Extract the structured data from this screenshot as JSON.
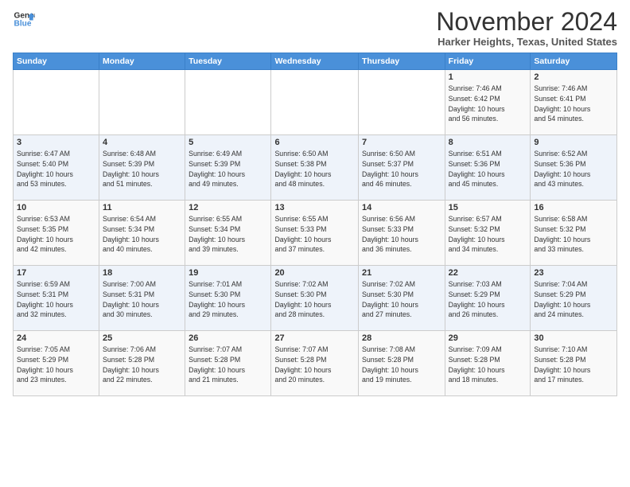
{
  "header": {
    "logo_line1": "General",
    "logo_line2": "Blue",
    "month": "November 2024",
    "location": "Harker Heights, Texas, United States"
  },
  "days_of_week": [
    "Sunday",
    "Monday",
    "Tuesday",
    "Wednesday",
    "Thursday",
    "Friday",
    "Saturday"
  ],
  "weeks": [
    [
      {
        "day": "",
        "info": ""
      },
      {
        "day": "",
        "info": ""
      },
      {
        "day": "",
        "info": ""
      },
      {
        "day": "",
        "info": ""
      },
      {
        "day": "",
        "info": ""
      },
      {
        "day": "1",
        "info": "Sunrise: 7:46 AM\nSunset: 6:42 PM\nDaylight: 10 hours\nand 56 minutes."
      },
      {
        "day": "2",
        "info": "Sunrise: 7:46 AM\nSunset: 6:41 PM\nDaylight: 10 hours\nand 54 minutes."
      }
    ],
    [
      {
        "day": "3",
        "info": "Sunrise: 6:47 AM\nSunset: 5:40 PM\nDaylight: 10 hours\nand 53 minutes."
      },
      {
        "day": "4",
        "info": "Sunrise: 6:48 AM\nSunset: 5:39 PM\nDaylight: 10 hours\nand 51 minutes."
      },
      {
        "day": "5",
        "info": "Sunrise: 6:49 AM\nSunset: 5:39 PM\nDaylight: 10 hours\nand 49 minutes."
      },
      {
        "day": "6",
        "info": "Sunrise: 6:50 AM\nSunset: 5:38 PM\nDaylight: 10 hours\nand 48 minutes."
      },
      {
        "day": "7",
        "info": "Sunrise: 6:50 AM\nSunset: 5:37 PM\nDaylight: 10 hours\nand 46 minutes."
      },
      {
        "day": "8",
        "info": "Sunrise: 6:51 AM\nSunset: 5:36 PM\nDaylight: 10 hours\nand 45 minutes."
      },
      {
        "day": "9",
        "info": "Sunrise: 6:52 AM\nSunset: 5:36 PM\nDaylight: 10 hours\nand 43 minutes."
      }
    ],
    [
      {
        "day": "10",
        "info": "Sunrise: 6:53 AM\nSunset: 5:35 PM\nDaylight: 10 hours\nand 42 minutes."
      },
      {
        "day": "11",
        "info": "Sunrise: 6:54 AM\nSunset: 5:34 PM\nDaylight: 10 hours\nand 40 minutes."
      },
      {
        "day": "12",
        "info": "Sunrise: 6:55 AM\nSunset: 5:34 PM\nDaylight: 10 hours\nand 39 minutes."
      },
      {
        "day": "13",
        "info": "Sunrise: 6:55 AM\nSunset: 5:33 PM\nDaylight: 10 hours\nand 37 minutes."
      },
      {
        "day": "14",
        "info": "Sunrise: 6:56 AM\nSunset: 5:33 PM\nDaylight: 10 hours\nand 36 minutes."
      },
      {
        "day": "15",
        "info": "Sunrise: 6:57 AM\nSunset: 5:32 PM\nDaylight: 10 hours\nand 34 minutes."
      },
      {
        "day": "16",
        "info": "Sunrise: 6:58 AM\nSunset: 5:32 PM\nDaylight: 10 hours\nand 33 minutes."
      }
    ],
    [
      {
        "day": "17",
        "info": "Sunrise: 6:59 AM\nSunset: 5:31 PM\nDaylight: 10 hours\nand 32 minutes."
      },
      {
        "day": "18",
        "info": "Sunrise: 7:00 AM\nSunset: 5:31 PM\nDaylight: 10 hours\nand 30 minutes."
      },
      {
        "day": "19",
        "info": "Sunrise: 7:01 AM\nSunset: 5:30 PM\nDaylight: 10 hours\nand 29 minutes."
      },
      {
        "day": "20",
        "info": "Sunrise: 7:02 AM\nSunset: 5:30 PM\nDaylight: 10 hours\nand 28 minutes."
      },
      {
        "day": "21",
        "info": "Sunrise: 7:02 AM\nSunset: 5:30 PM\nDaylight: 10 hours\nand 27 minutes."
      },
      {
        "day": "22",
        "info": "Sunrise: 7:03 AM\nSunset: 5:29 PM\nDaylight: 10 hours\nand 26 minutes."
      },
      {
        "day": "23",
        "info": "Sunrise: 7:04 AM\nSunset: 5:29 PM\nDaylight: 10 hours\nand 24 minutes."
      }
    ],
    [
      {
        "day": "24",
        "info": "Sunrise: 7:05 AM\nSunset: 5:29 PM\nDaylight: 10 hours\nand 23 minutes."
      },
      {
        "day": "25",
        "info": "Sunrise: 7:06 AM\nSunset: 5:28 PM\nDaylight: 10 hours\nand 22 minutes."
      },
      {
        "day": "26",
        "info": "Sunrise: 7:07 AM\nSunset: 5:28 PM\nDaylight: 10 hours\nand 21 minutes."
      },
      {
        "day": "27",
        "info": "Sunrise: 7:07 AM\nSunset: 5:28 PM\nDaylight: 10 hours\nand 20 minutes."
      },
      {
        "day": "28",
        "info": "Sunrise: 7:08 AM\nSunset: 5:28 PM\nDaylight: 10 hours\nand 19 minutes."
      },
      {
        "day": "29",
        "info": "Sunrise: 7:09 AM\nSunset: 5:28 PM\nDaylight: 10 hours\nand 18 minutes."
      },
      {
        "day": "30",
        "info": "Sunrise: 7:10 AM\nSunset: 5:28 PM\nDaylight: 10 hours\nand 17 minutes."
      }
    ]
  ]
}
